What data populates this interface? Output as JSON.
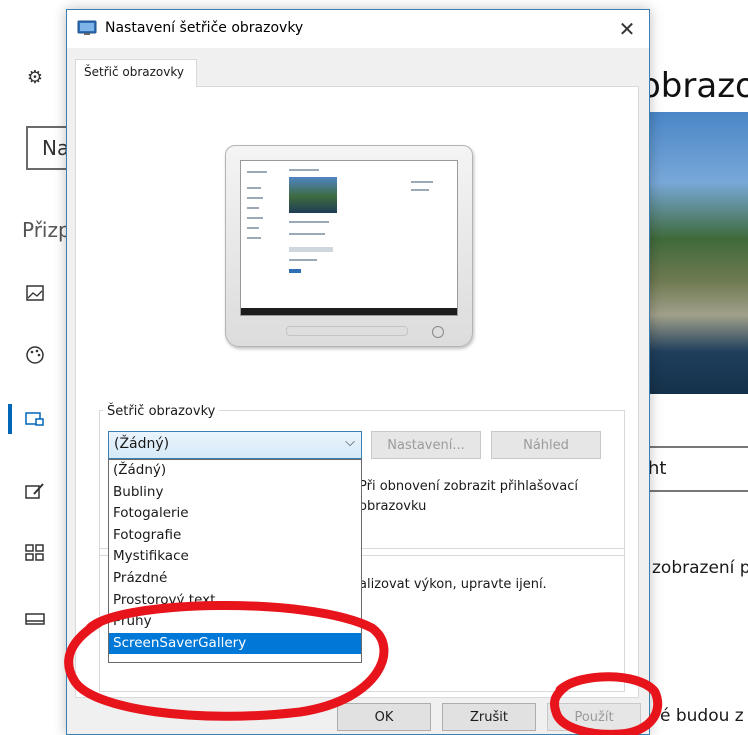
{
  "background_app": {
    "search_value": "Na",
    "section_label": "Přizp",
    "page_title": "obrazo",
    "dropdown_value": "ht",
    "text_line1": "zobrazení p",
    "text_line2": "é budou z",
    "nav_icons": [
      "gear-icon",
      "image-icon",
      "palette-icon",
      "lockscreen-icon",
      "themes-icon",
      "start-icon",
      "taskbar-icon"
    ]
  },
  "dialog": {
    "title": "Nastavení šetřiče obrazovky",
    "close_label": "✕",
    "tab_label": "Šetřič obrazovky",
    "group_label": "Šetřič obrazovky",
    "combo_value": "(Žádný)",
    "settings_button": "Nastavení...",
    "preview_button": "Náhled",
    "resume_text": "Při obnovení zobrazit přihlašovací obrazovku",
    "power_text": "alizovat výkon, upravte ijení.",
    "dropdown_options": [
      "(Žádný)",
      "Bubliny",
      "Fotogalerie",
      "Fotografie",
      "Mystifikace",
      "Prázdné",
      "Prostorový text",
      "Pruhy",
      "ScreenSaverGallery"
    ],
    "selected_option_index": 8,
    "ok_button": "OK",
    "cancel_button": "Zrušit",
    "apply_button": "Použít"
  },
  "colors": {
    "selection": "#0078d7",
    "annotation": "#e8141b",
    "title_bar_border": "#3c7fb1"
  }
}
